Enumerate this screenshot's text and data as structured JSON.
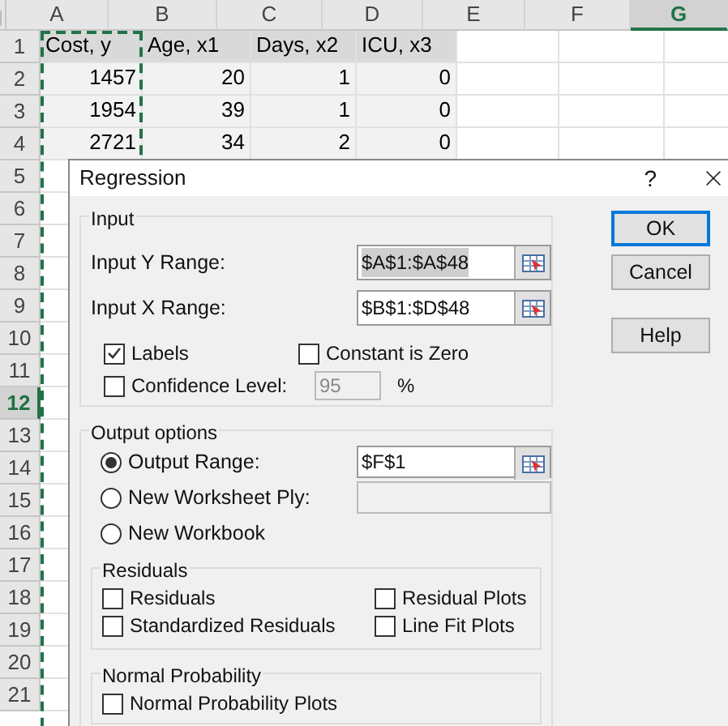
{
  "spreadsheet": {
    "columns": [
      {
        "label": "A",
        "selected": false
      },
      {
        "label": "B",
        "selected": false
      },
      {
        "label": "C",
        "selected": false
      },
      {
        "label": "D",
        "selected": false
      },
      {
        "label": "E",
        "selected": false
      },
      {
        "label": "F",
        "selected": false
      },
      {
        "label": "G",
        "selected": true
      }
    ],
    "rows": [
      {
        "number": "1",
        "selected": false,
        "kind": "header",
        "cells": [
          "Cost, y",
          "Age, x1",
          "Days, x2",
          "ICU, x3"
        ]
      },
      {
        "number": "2",
        "selected": false,
        "kind": "data",
        "cells": [
          "1457",
          "20",
          "1",
          "0"
        ]
      },
      {
        "number": "3",
        "selected": false,
        "kind": "data",
        "cells": [
          "1954",
          "39",
          "1",
          "0"
        ]
      },
      {
        "number": "4",
        "selected": false,
        "kind": "data",
        "cells": [
          "2721",
          "34",
          "2",
          "0"
        ]
      },
      {
        "number": "5",
        "selected": false
      },
      {
        "number": "6",
        "selected": false
      },
      {
        "number": "7",
        "selected": false
      },
      {
        "number": "8",
        "selected": false
      },
      {
        "number": "9",
        "selected": false
      },
      {
        "number": "10",
        "selected": false
      },
      {
        "number": "11",
        "selected": false
      },
      {
        "number": "12",
        "selected": true
      },
      {
        "number": "13",
        "selected": false
      },
      {
        "number": "14",
        "selected": false
      },
      {
        "number": "15",
        "selected": false
      },
      {
        "number": "16",
        "selected": false
      },
      {
        "number": "17",
        "selected": false
      },
      {
        "number": "18",
        "selected": false
      },
      {
        "number": "19",
        "selected": false
      },
      {
        "number": "20",
        "selected": false
      },
      {
        "number": "21",
        "selected": false
      }
    ]
  },
  "dialog": {
    "title": "Regression",
    "help": "?",
    "input": {
      "legend": "Input",
      "ranges": [
        {
          "label": "Input Y Range:",
          "value": "$A$1:$A$48",
          "selected": true
        },
        {
          "label": "Input X Range:",
          "value": "$B$1:$D$48",
          "selected": false
        }
      ],
      "labels": {
        "label": "Labels",
        "checked": true
      },
      "constant_zero": {
        "label": "Constant is Zero",
        "checked": false
      },
      "confidence": {
        "label": "Confidence Level:",
        "checked": false,
        "value": "95",
        "disabled": true,
        "unit": "%"
      }
    },
    "output": {
      "legend": "Output options",
      "choices": [
        {
          "label": "Output Range:",
          "selected": true,
          "kind": "range",
          "value": "$F$1"
        },
        {
          "label": "New Worksheet Ply:",
          "selected": false,
          "kind": "field"
        },
        {
          "label": "New Workbook",
          "selected": false,
          "kind": "plain"
        }
      ]
    },
    "residuals": {
      "legend": "Residuals",
      "items": [
        {
          "label": "Residuals",
          "checked": false
        },
        {
          "label": "Residual Plots",
          "checked": false
        },
        {
          "label": "Standardized Residuals",
          "checked": false
        },
        {
          "label": "Line Fit Plots",
          "checked": false
        }
      ]
    },
    "normal": {
      "legend": "Normal Probability",
      "items": [
        {
          "label": "Normal Probability Plots",
          "checked": false
        }
      ]
    },
    "buttons": [
      {
        "label": "OK",
        "focused": true
      },
      {
        "label": "Cancel",
        "focused": false
      },
      {
        "label": "Help",
        "focused": false
      }
    ]
  }
}
